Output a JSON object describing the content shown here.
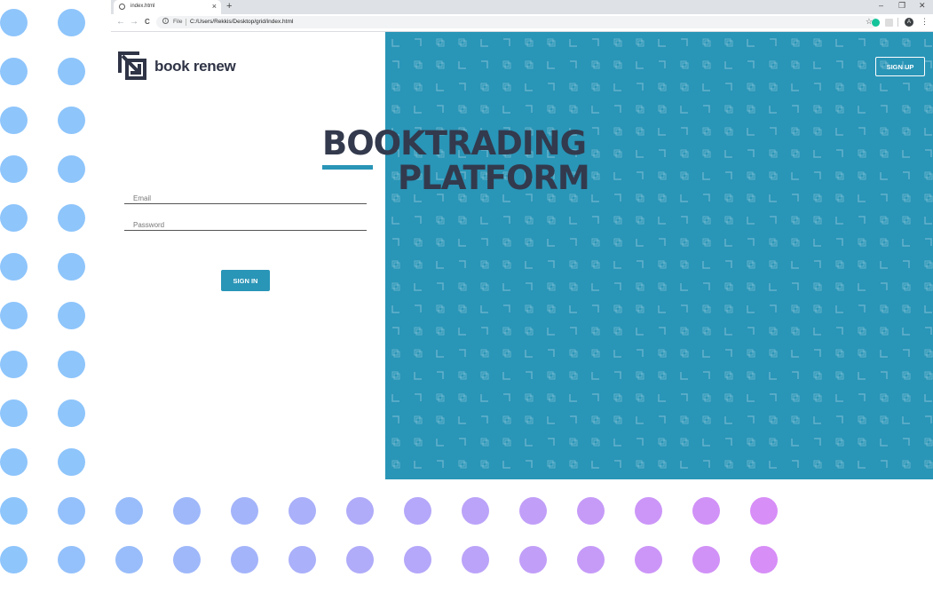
{
  "browser": {
    "tab_title": "index.html",
    "tab_close": "×",
    "new_tab": "+",
    "window_controls": {
      "minimize": "–",
      "restore": "❐",
      "close": "✕"
    },
    "nav": {
      "back": "←",
      "forward": "→",
      "reload": "C"
    },
    "address": {
      "scheme_label": "File",
      "url": "C:/Users/Rekkis/Desktop/grid/index.html"
    },
    "bookmark_icon": "star-icon",
    "extensions": [
      {
        "name": "grammarly-icon",
        "color": "#15c39a"
      },
      {
        "name": "extension-icon",
        "color": "#dddddd"
      }
    ],
    "profile_initial": "A",
    "menu_glyph": "⋮"
  },
  "page": {
    "brand": "book renew",
    "headline_line1": "BOOKTRADING",
    "headline_line2": "PLATFORM",
    "email_placeholder": "Email",
    "password_placeholder": "Password",
    "signin_label": "SIGN IN",
    "signup_label": "SIGN UP"
  },
  "colors": {
    "accent": "#2995b7",
    "dark_text": "#333a4d",
    "dot_gradient_start": "#8ec5fb",
    "dot_gradient_end": "#d78ef7"
  }
}
